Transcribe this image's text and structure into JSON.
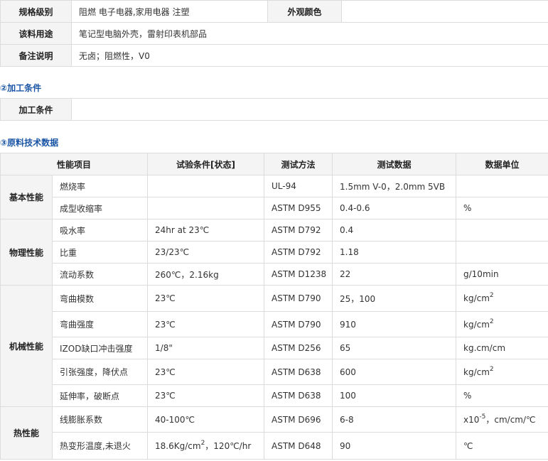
{
  "spec": {
    "grade_label": "规格级别",
    "grade_value": "阻燃 电子电器,家用电器 注塑",
    "color_label": "外观颜色",
    "color_value": "",
    "usage_label": "该料用途",
    "usage_value": "笔记型电脑外壳，雷射印表机部品",
    "note_label": "备注说明",
    "note_value": "无卤；阻燃性，V0"
  },
  "processing": {
    "title": "②加工条件",
    "label": "加工条件",
    "value": ""
  },
  "tech": {
    "title": "③原料技术数据",
    "headers": [
      "性能项目",
      "试验条件[状态]",
      "测试方法",
      "测试数据",
      "数据单位"
    ],
    "groups": [
      {
        "name": "基本性能",
        "rows": [
          {
            "item": "燃烧率",
            "cond": "",
            "method": "UL-94",
            "value": "1.5mm V-0，2.0mm 5VB",
            "unit": ""
          },
          {
            "item": "成型收缩率",
            "cond": "",
            "method": "ASTM D955",
            "value": "0.4-0.6",
            "unit": "%"
          }
        ]
      },
      {
        "name": "物理性能",
        "rows": [
          {
            "item": "吸水率",
            "cond": "24hr at 23℃",
            "method": "ASTM D792",
            "value": "0.4",
            "unit": ""
          },
          {
            "item": "比重",
            "cond": "23/23℃",
            "method": "ASTM D792",
            "value": "1.18",
            "unit": ""
          },
          {
            "item": "流动系数",
            "cond": "260℃，2.16kg",
            "method": "ASTM D1238",
            "value": "22",
            "unit": "g/10min"
          }
        ]
      },
      {
        "name": "机械性能",
        "rows": [
          {
            "item": "弯曲模数",
            "cond": "23℃",
            "method": "ASTM D790",
            "value": "25，100",
            "unit": "kg/cm",
            "unit_sup": "2"
          },
          {
            "item": "弯曲强度",
            "cond": "23℃",
            "method": "ASTM D790",
            "value": "910",
            "unit": "kg/cm",
            "unit_sup": "2"
          },
          {
            "item": "IZOD缺口冲击强度",
            "cond": "1/8\"",
            "method": "ASTM D256",
            "value": "65",
            "unit": "kg.cm/cm"
          },
          {
            "item": "引张强度，降伏点",
            "cond": "23℃",
            "method": "ASTM D638",
            "value": "600",
            "unit": "kg/cm",
            "unit_sup": "2"
          },
          {
            "item": "延伸率，破断点",
            "cond": "23℃",
            "method": "ASTM D638",
            "value": "100",
            "unit": "%"
          }
        ]
      },
      {
        "name": "热性能",
        "rows": [
          {
            "item": "线膨胀系数",
            "cond": "40-100℃",
            "method": "ASTM D696",
            "value": "6-8",
            "unit": "x10",
            "unit_sup": "-5",
            "unit_tail": "，cm/cm/℃"
          },
          {
            "item": "热变形温度,未退火",
            "cond": "18.6Kg/cm",
            "cond_sup": "2",
            "cond_tail": "，120℃/hr",
            "method": "ASTM D648",
            "value": "90",
            "unit": "℃"
          }
        ]
      }
    ]
  }
}
